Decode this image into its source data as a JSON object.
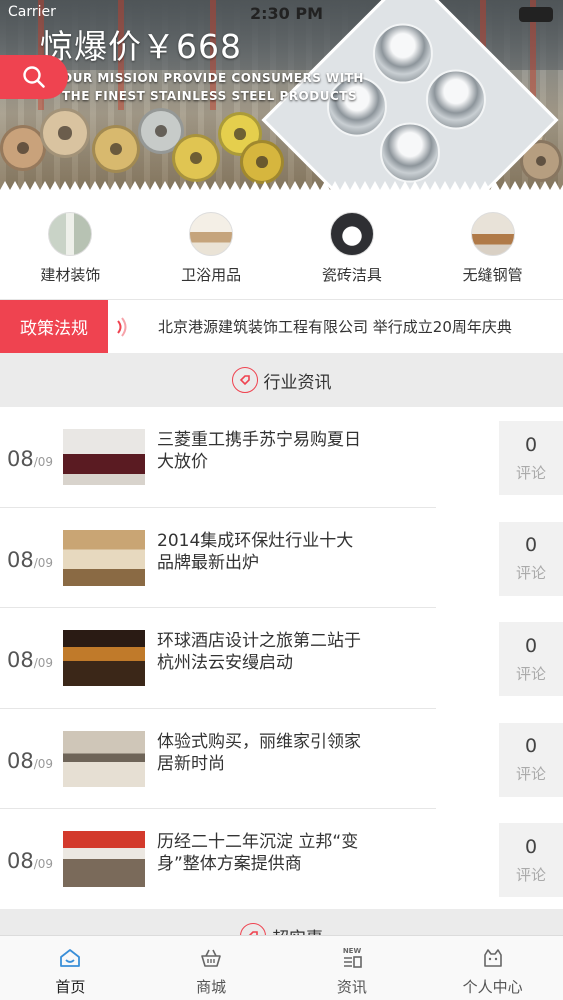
{
  "status_bar": {
    "carrier": "Carrier",
    "time": "2:30 PM"
  },
  "banner": {
    "title": "惊爆价￥668",
    "subtitle_line1": "OUR MISSION  PROVIDE CONSUMERS WITH",
    "subtitle_line2": "THE FINEST STAINLESS STEEL PRODUCTS"
  },
  "categories": [
    {
      "label": "建材装饰",
      "icon": "building-material-icon"
    },
    {
      "label": "卫浴用品",
      "icon": "bathroom-icon"
    },
    {
      "label": "瓷砖洁具",
      "icon": "ceramic-tile-icon"
    },
    {
      "label": "无缝钢管",
      "icon": "seamless-pipe-icon"
    }
  ],
  "ticker": {
    "tag": "政策法规",
    "text": "北京港源建筑装饰工程有限公司 举行成立20周年庆典"
  },
  "sections": {
    "industry_news": "行业资讯",
    "next": "超实惠"
  },
  "news": [
    {
      "month": "08",
      "day": "/09",
      "title": "三菱重工携手苏宁易购夏日大放价",
      "comments": "0",
      "comments_label": "评论"
    },
    {
      "month": "08",
      "day": "/09",
      "title": "2014集成环保灶行业十大品牌最新出炉",
      "comments": "0",
      "comments_label": "评论"
    },
    {
      "month": "08",
      "day": "/09",
      "title": "环球酒店设计之旅第二站于杭州法云安缦启动",
      "comments": "0",
      "comments_label": "评论"
    },
    {
      "month": "08",
      "day": "/09",
      "title": "体验式购买，丽维家引领家居新时尚",
      "comments": "0",
      "comments_label": "评论"
    },
    {
      "month": "08",
      "day": "/09",
      "title": "历经二十二年沉淀 立邦“变身”整体方案提供商",
      "comments": "0",
      "comments_label": "评论"
    }
  ],
  "tabs": [
    {
      "label": "首页",
      "icon": "home-icon",
      "active": true
    },
    {
      "label": "商城",
      "icon": "basket-icon",
      "active": false
    },
    {
      "label": "资讯",
      "icon": "news-icon",
      "icon_text": "NEW",
      "active": false
    },
    {
      "label": "个人中心",
      "icon": "profile-icon",
      "active": false
    }
  ],
  "colors": {
    "accent": "#ef4350",
    "tab_active": "#3a8fd8"
  }
}
